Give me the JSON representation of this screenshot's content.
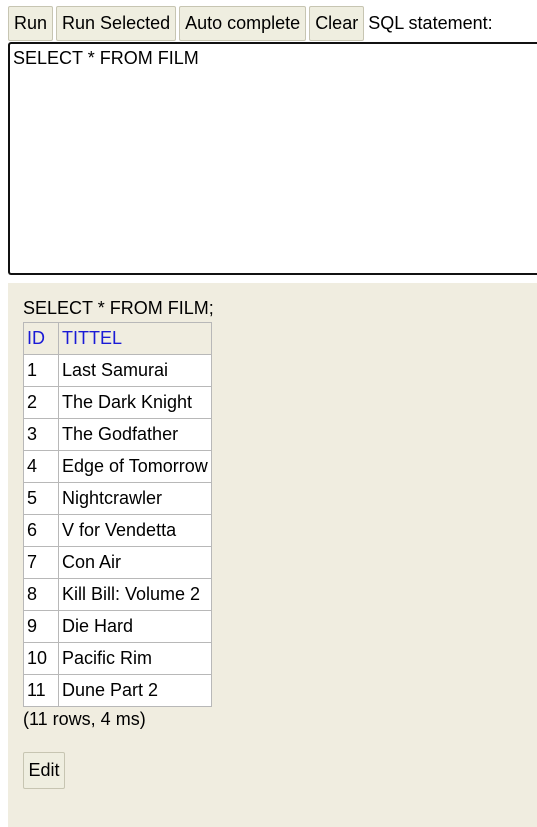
{
  "toolbar": {
    "run_label": "Run",
    "run_selected_label": "Run Selected",
    "auto_complete_label": "Auto complete",
    "clear_label": "Clear",
    "sql_statement_label": "SQL statement:"
  },
  "editor": {
    "sql_text": "SELECT * FROM FILM"
  },
  "results": {
    "query_echo": "SELECT * FROM FILM;",
    "columns": [
      "ID",
      "TITTEL"
    ],
    "rows": [
      [
        "1",
        "Last Samurai"
      ],
      [
        "2",
        "The Dark Knight"
      ],
      [
        "3",
        "The Godfather"
      ],
      [
        "4",
        "Edge of Tomorrow"
      ],
      [
        "5",
        "Nightcrawler"
      ],
      [
        "6",
        "V for Vendetta"
      ],
      [
        "7",
        "Con Air"
      ],
      [
        "8",
        "Kill Bill: Volume 2"
      ],
      [
        "9",
        "Die Hard"
      ],
      [
        "10",
        "Pacific Rim"
      ],
      [
        "11",
        "Dune Part 2"
      ]
    ],
    "row_count_text": "(11 rows, 4 ms)",
    "edit_label": "Edit"
  },
  "colors": {
    "button_bg": "#efeee0",
    "results_bg": "#f0ede0",
    "header_text": "#1a1ad6"
  }
}
